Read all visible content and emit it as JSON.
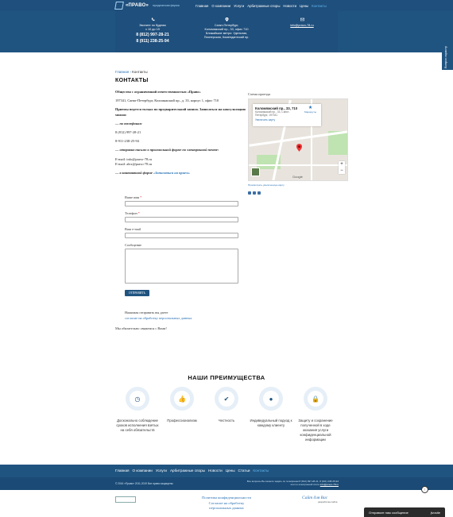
{
  "header": {
    "brand": "«ПРАВО»",
    "brand_sub": "юридическая фирма",
    "nav": [
      "Главная",
      "О компании",
      "Услуги",
      "Арбитражные споры",
      "Новости",
      "Цены",
      "Контакты"
    ],
    "phones": {
      "hours": "Звоните по будням",
      "time": "с 10 до 19",
      "phone1": "8 (812) 997-28-21",
      "phone2": "8 (911) 238-25-94"
    },
    "address": {
      "city": "Санкт-Петербург,",
      "street": "Коломяжский пр., 33, офис 710",
      "metro_label": "Ближайшие метро: Удельная,",
      "metro2": "Пионерская, Комендантский пр."
    },
    "email": "info@pravo-78.ru"
  },
  "callback_tab": "Вопрос юристу",
  "breadcrumb": {
    "home": "Главная",
    "sep": " › ",
    "current": "Контакты"
  },
  "page_title": "КОНТАКТЫ",
  "company_name": "Общество с ограниченной ответственностью «Право»",
  "company_address": "197341, Санкт-Петербург, Коломяжский пр., д. 33, корпус 1, офис 710",
  "appointment": "Приемы ведется только по предварительной записи. Записаться на консультацию можно:",
  "by_phone_label": "— по телефонам",
  "phone1": "8 (812) 997-28-21",
  "phone2": "8-911-238-25-94",
  "by_email_label": "— отправив письмо в произвольной форме по электронной почте:",
  "email1": "E-mail: info@pravo-78.ru",
  "email2": "E-mail: alex@pravo-78.ru",
  "by_form_label": "— в контактной форме",
  "by_form_link": "«Записаться на прием»",
  "map": {
    "title": "Схема проезда",
    "place": "Коломяжский пр., 33, 710",
    "place_sub1": "Коломяжский пр., 33, Санкт-",
    "place_sub2": "Петербург, 197341",
    "place_link": "Увеличить карту",
    "route": "Маршруты",
    "google": "Google",
    "caption": "Просмотреть увеличенную карту"
  },
  "form": {
    "name_label": "Ваше имя",
    "phone_label": "Телефон",
    "email_label": "Ваш e-mail",
    "message_label": "Сообщение",
    "required_mark": "*",
    "submit": "ОТПРАВИТЬ"
  },
  "agree_text": "Нажимая отправить вы даете",
  "agree_link": "согласие на обработку персональных данных",
  "answer_text": "Мы обязательно свяжемся с Вами!",
  "advantages": {
    "title": "НАШИ ПРЕИМУЩЕСТВА",
    "items": [
      {
        "label": "Досконально соблюдение сроков исполнения взятых на себя обязательств",
        "icon": "clock-icon"
      },
      {
        "label": "Профессионализм",
        "icon": "thumbs-up-icon"
      },
      {
        "label": "Честность",
        "icon": "check-icon"
      },
      {
        "label": "Индивидуальный подход к каждому клиенту",
        "icon": "person-icon"
      },
      {
        "label": "Защиту и сохранение полученной в ходе оказания услуги конфиденциальной информации",
        "icon": "lock-icon"
      }
    ]
  },
  "footer": {
    "nav": [
      "Главная",
      "О компании",
      "Услуги",
      "Арбитражные споры",
      "Новости",
      "Цены",
      "Статьи",
      "Контакты"
    ],
    "copyright": "© 2016 «Право» 2011-2019 Все права защищены",
    "info1": "Все вопросы Вы можете задать по телефонам 8 (812) 997-28-21, 8 (911) 238-25-94",
    "info2": "или по электронной почте",
    "info_email": "info@pravo-78.ru",
    "policy1": "Политика конфиденциальности",
    "policy2": "Согласие на обработку",
    "policy3": "персональных данных",
    "dev_name": "Сайт для Вас",
    "dev_sub": "разработка сайта",
    "chat_label": "Отправьте нам сообщение",
    "chat_brand": "jivosite"
  }
}
